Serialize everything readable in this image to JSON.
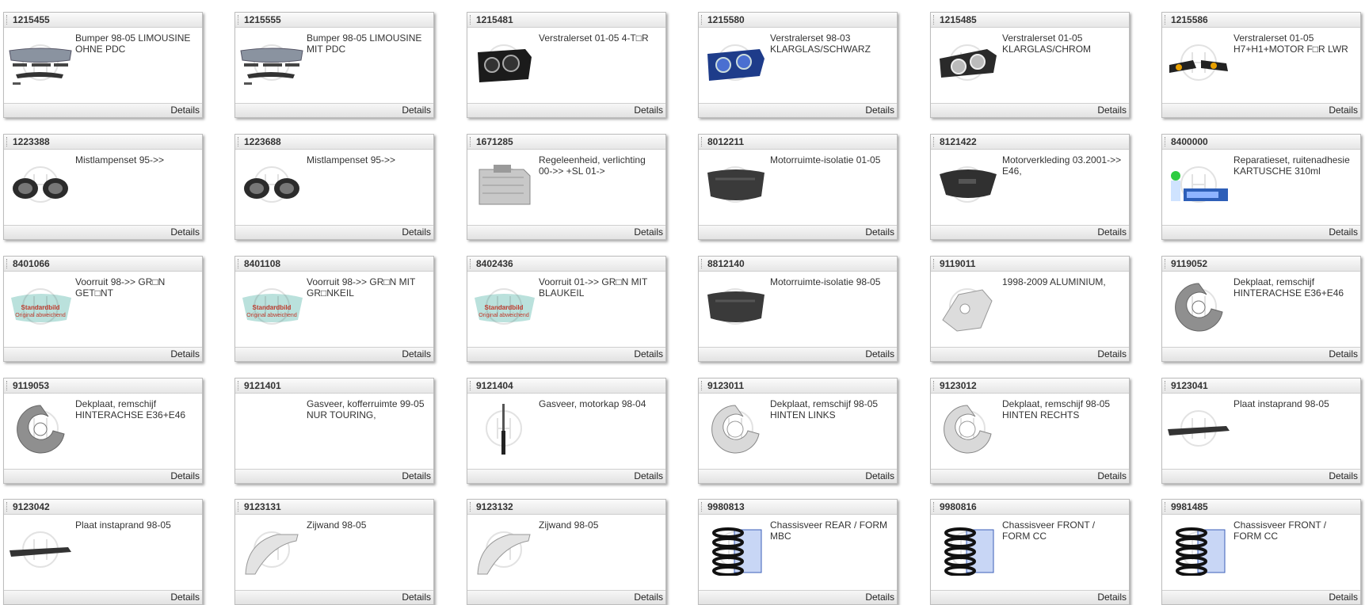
{
  "details_label": "Details",
  "colors": {
    "card_border": "#bdbdbd",
    "header_bg": "#e6e6e6",
    "text": "#333333",
    "standard_badge_red": "#c0392b"
  },
  "products": [
    {
      "sku": "1215455",
      "desc": "Bumper 98-05 LIMOUSINE\nOHNE PDC",
      "icon": "bumper-set-image"
    },
    {
      "sku": "1215555",
      "desc": "Bumper 98-05 LIMOUSINE\nMIT PDC",
      "icon": "bumper-set-image"
    },
    {
      "sku": "1215481",
      "desc": "Verstralerset 01-05 4-T□R",
      "icon": "headlight-black-image"
    },
    {
      "sku": "1215580",
      "desc": "Verstralerset 98-03\nKLARGLAS/SCHWARZ",
      "icon": "headlight-blue-image"
    },
    {
      "sku": "1215485",
      "desc": "Verstralerset 01-05\nKLARGLAS/CHROM",
      "icon": "headlight-chrome-image"
    },
    {
      "sku": "1215586",
      "desc": "Verstralerset 01-05\nH7+H1+MOTOR F□R LWR",
      "icon": "headlight-pair-image"
    },
    {
      "sku": "1223388",
      "desc": "Mistlampenset 95->>",
      "icon": "foglamp-set-image"
    },
    {
      "sku": "1223688",
      "desc": "Mistlampenset 95->>",
      "icon": "foglamp-set-image"
    },
    {
      "sku": "1671285",
      "desc": "Regeleenheid, verlichting\n00->> +SL 01->",
      "icon": "control-unit-image"
    },
    {
      "sku": "8012211",
      "desc": "Motorruimte-isolatie 01-05",
      "icon": "engine-insulation-image"
    },
    {
      "sku": "8121422",
      "desc": "Motorverkleding 03.2001->>\nE46,",
      "icon": "engine-cover-image"
    },
    {
      "sku": "8400000",
      "desc": "Reparatieset, ruitenadhesie\nKARTUSCHE 310ml",
      "icon": "repair-kit-image"
    },
    {
      "sku": "8401066",
      "desc": "Voorruit 98->> GR□N\nGET□NT",
      "icon": "windshield-placeholder-image"
    },
    {
      "sku": "8401108",
      "desc": "Voorruit 98->> GR□N MIT\nGR□NKEIL",
      "icon": "windshield-placeholder-image"
    },
    {
      "sku": "8402436",
      "desc": "Voorruit 01->> GR□N MIT\nBLAUKEIL",
      "icon": "windshield-placeholder-image"
    },
    {
      "sku": "8812140",
      "desc": "Motorruimte-isolatie 98-05",
      "icon": "engine-insulation-image"
    },
    {
      "sku": "9119011",
      "desc": "1998-2009 ALUMINIUM,",
      "icon": "aluminium-bracket-image"
    },
    {
      "sku": "9119052",
      "desc": "Dekplaat, remschijf\nHINTERACHSE E36+E46",
      "icon": "dust-shield-image"
    },
    {
      "sku": "9119053",
      "desc": "Dekplaat, remschijf\nHINTERACHSE E36+E46",
      "icon": "dust-shield-image"
    },
    {
      "sku": "9121401",
      "desc": "Gasveer, kofferruimte 99-05\nNUR TOURING,",
      "icon": "none"
    },
    {
      "sku": "9121404",
      "desc": "Gasveer, motorkap 98-04",
      "icon": "gas-strut-image"
    },
    {
      "sku": "9123011",
      "desc": "Dekplaat, remschijf 98-05\nHINTEN LINKS",
      "icon": "dust-shield-silver-image"
    },
    {
      "sku": "9123012",
      "desc": "Dekplaat, remschijf 98-05\nHINTEN RECHTS",
      "icon": "dust-shield-silver-image"
    },
    {
      "sku": "9123041",
      "desc": "Plaat instaprand 98-05",
      "icon": "sill-plate-image"
    },
    {
      "sku": "9123042",
      "desc": "Plaat instaprand 98-05",
      "icon": "sill-plate-image"
    },
    {
      "sku": "9123131",
      "desc": "Zijwand 98-05",
      "icon": "wheel-arch-image"
    },
    {
      "sku": "9123132",
      "desc": "Zijwand 98-05",
      "icon": "wheel-arch-image"
    },
    {
      "sku": "9980813",
      "desc": "Chassisveer REAR / FORM\nMBC",
      "icon": "coil-spring-image"
    },
    {
      "sku": "9980816",
      "desc": "Chassisveer FRONT /\nFORM CC",
      "icon": "coil-spring-image"
    },
    {
      "sku": "9981485",
      "desc": "Chassisveer FRONT /\nFORM CC",
      "icon": "coil-spring-image"
    }
  ],
  "placeholder": {
    "line1": "Standardbild",
    "line2": "Original abweichend"
  }
}
